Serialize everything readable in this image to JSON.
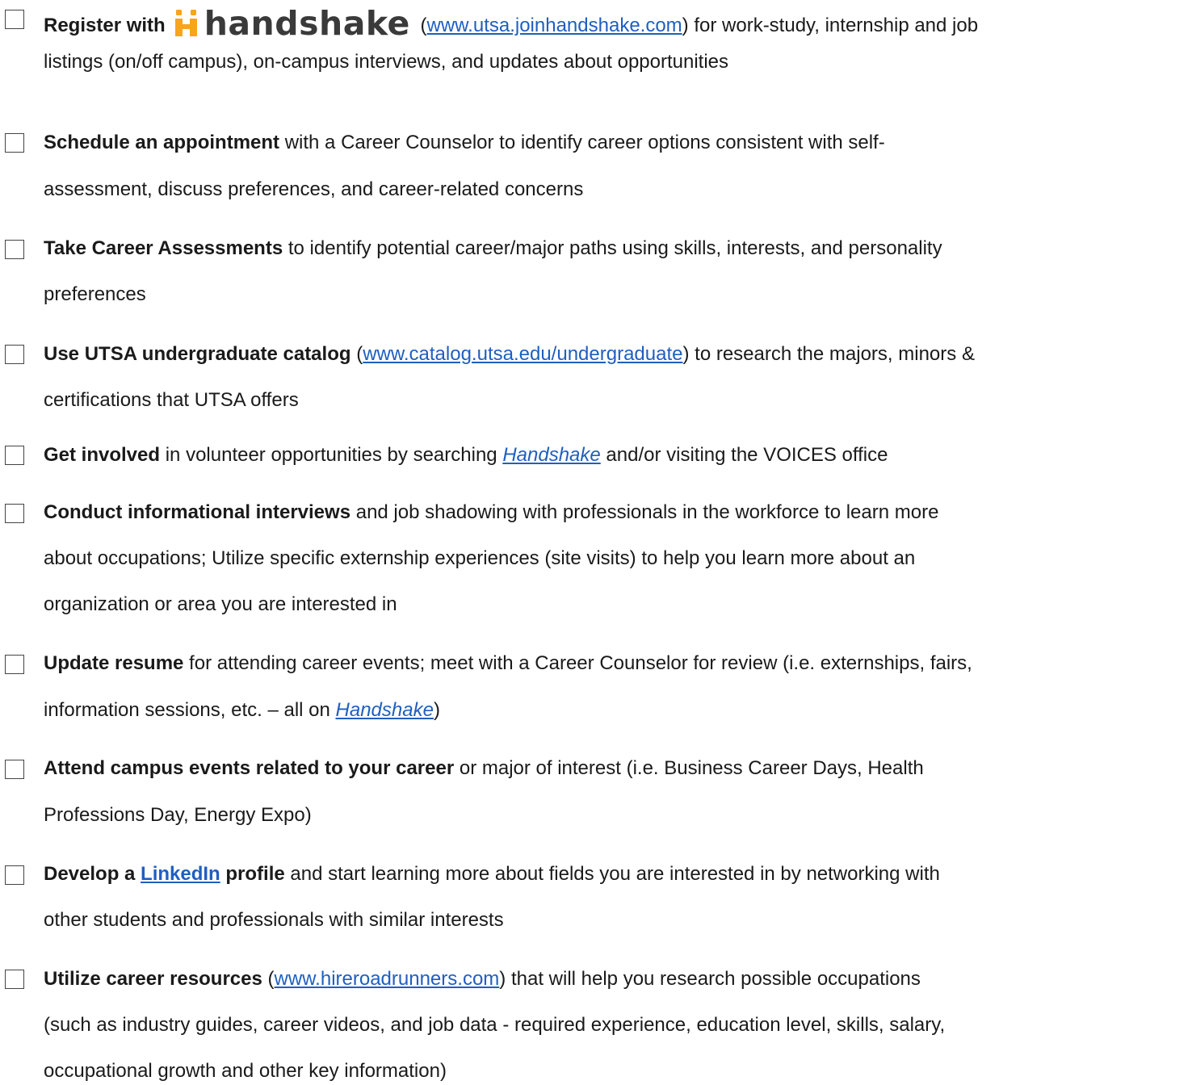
{
  "items": [
    {
      "lead": "Register with",
      "logo_text": "handshake",
      "link": "www.utsa.joinhandshake.com",
      "tail": " for work-study, internship and job",
      "line2": "listings (on/off campus), on-campus interviews, and updates about opportunities"
    },
    {
      "lead": "Schedule an appointment",
      "tail": " with a Career Counselor to identify career options consistent with self-",
      "line2": "assessment, discuss preferences, and career-related concerns"
    },
    {
      "lead": "Take Career Assessments",
      "tail": " to identify potential career/major paths using skills, interests, and personality",
      "line2": "preferences"
    },
    {
      "lead": "Use UTSA undergraduate catalog",
      "link": "www.catalog.utsa.edu/undergraduate",
      "tail": " to research the majors, minors &",
      "line2": "certifications that UTSA offers"
    },
    {
      "lead": "Get involved",
      "mid": " in volunteer opportunities by searching ",
      "link": "Handshake",
      "tail": " and/or visiting the VOICES office"
    },
    {
      "lead": "Conduct informational interviews",
      "tail": " and job shadowing with professionals in the workforce to learn more",
      "line2": "about occupations; Utilize specific externship experiences (site visits) to help you learn more about an",
      "line3": "organization or area you are interested in"
    },
    {
      "lead": "Update resume",
      "tail": " for attending career events; meet with a Career Counselor for review (i.e. externships, fairs,",
      "line2_pre": "information sessions, etc. – all on ",
      "link": "Handshake",
      "line2_post": ")"
    },
    {
      "lead": "Attend campus events related to your career",
      "tail": " or major of interest (i.e. Business Career Days, Health",
      "line2": "Professions Day, Energy Expo)"
    },
    {
      "lead": "Develop a ",
      "link": "LinkedIn",
      "lead2": " profile",
      "tail": " and start learning more about fields you are interested in by networking with",
      "line2": "other students and professionals with similar interests"
    },
    {
      "lead": "Utilize career resources",
      "link": "www.hireroadrunners.com",
      "tail": " that will help you research possible occupations",
      "line2": " (such as industry guides, career videos, and job data - required experience, education level, skills, salary,",
      "line3": "occupational growth and other key information)"
    }
  ],
  "colors": {
    "link": "#1f5fbf",
    "logo_orange": "#f7a51c",
    "logo_text": "#3a3a3a"
  }
}
